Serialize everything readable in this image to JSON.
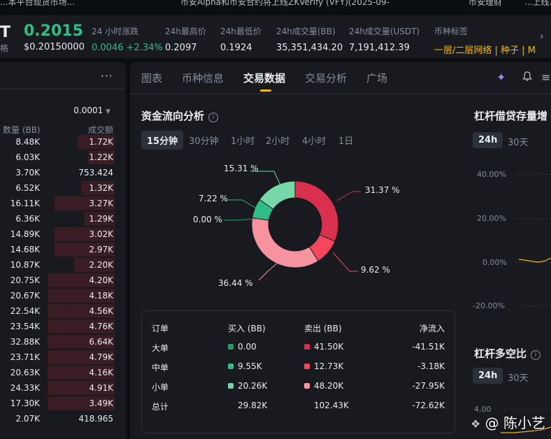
{
  "news": [
    "...本平台现货市场...",
    "币安Alpha和币安合约将上线ZKVerify (VFY)(2025-09-",
    "币安理财",
    "...上线..."
  ],
  "ticker": {
    "symbol": "T",
    "symbol_sub": "格",
    "price": "0.2015",
    "price_sub": "$0.20150000",
    "stats": [
      {
        "label": "24 小时涨跌",
        "value": "0.0046 +2.34%",
        "tone": "green"
      },
      {
        "label": "24h最高价",
        "value": "0.2097",
        "tone": ""
      },
      {
        "label": "24h最低价",
        "value": "0.1924",
        "tone": ""
      },
      {
        "label": "24h成交量(BB)",
        "value": "35,351,434.20",
        "tone": ""
      },
      {
        "label": "24h成交量(USDT)",
        "value": "7,191,412.39",
        "tone": ""
      },
      {
        "label": "币种标签",
        "value": "一层/二层网络 | 种子 | Me",
        "tone": "yellow"
      }
    ]
  },
  "orderbook": {
    "precision": "0.0001",
    "col_qty": "数量 (BB)",
    "col_total": "成交额",
    "rows": [
      {
        "qty": "8.48K",
        "total": "1.72K",
        "depth": 0.55
      },
      {
        "qty": "6.03K",
        "total": "1.22K",
        "depth": 0.4
      },
      {
        "qty": "3.70K",
        "total": "753.424",
        "depth": 0.0
      },
      {
        "qty": "6.52K",
        "total": "1.32K",
        "depth": 0.5
      },
      {
        "qty": "16.11K",
        "total": "3.27K",
        "depth": 0.9
      },
      {
        "qty": "6.36K",
        "total": "1.29K",
        "depth": 0.45
      },
      {
        "qty": "14.89K",
        "total": "3.02K",
        "depth": 0.9
      },
      {
        "qty": "14.68K",
        "total": "2.97K",
        "depth": 0.9
      },
      {
        "qty": "10.87K",
        "total": "2.20K",
        "depth": 0.6
      },
      {
        "qty": "20.75K",
        "total": "4.20K",
        "depth": 1.0
      },
      {
        "qty": "20.67K",
        "total": "4.18K",
        "depth": 1.0
      },
      {
        "qty": "22.54K",
        "total": "4.56K",
        "depth": 1.0
      },
      {
        "qty": "23.54K",
        "total": "4.76K",
        "depth": 1.0
      },
      {
        "qty": "32.88K",
        "total": "6.64K",
        "depth": 1.0
      },
      {
        "qty": "23.71K",
        "total": "4.79K",
        "depth": 1.0
      },
      {
        "qty": "20.63K",
        "total": "4.16K",
        "depth": 1.0
      },
      {
        "qty": "24.33K",
        "total": "4.91K",
        "depth": 1.0
      },
      {
        "qty": "17.30K",
        "total": "3.49K",
        "depth": 1.0
      },
      {
        "qty": "2.07K",
        "total": "418.965",
        "depth": 0.0
      }
    ]
  },
  "tabs": [
    "图表",
    "币种信息",
    "交易数据",
    "交易分析",
    "广场"
  ],
  "active_tab": 2,
  "fund_flow": {
    "title": "资金流向分析",
    "intervals": [
      "15分钟",
      "30分钟",
      "1小时",
      "2小时",
      "4小时",
      "1日"
    ],
    "active_interval": 0,
    "table": {
      "headers": [
        "订单",
        "买入 (BB)",
        "卖出 (BB)",
        "净流入"
      ],
      "rows": [
        {
          "name": "大单",
          "buy": "0.00",
          "sell": "41.50K",
          "net": "-41.51K",
          "buy_color": "#1e9e63",
          "sell_color": "#d9304e"
        },
        {
          "name": "中单",
          "buy": "9.55K",
          "sell": "12.73K",
          "net": "-3.18K",
          "buy_color": "#2ebd85",
          "sell_color": "#f6465d"
        },
        {
          "name": "小单",
          "buy": "20.26K",
          "sell": "48.20K",
          "net": "-27.95K",
          "buy_color": "#76d8a8",
          "sell_color": "#f7939e"
        },
        {
          "name": "总计",
          "buy": "29.82K",
          "sell": "102.43K",
          "net": "-72.62K",
          "buy_color": "",
          "sell_color": ""
        }
      ]
    }
  },
  "chart_data": {
    "type": "pie",
    "title": "资金流向分析",
    "slices": [
      {
        "label": "31.37 %",
        "value": 31.37,
        "color": "#d9304e"
      },
      {
        "label": "9.62 %",
        "value": 9.62,
        "color": "#f6465d"
      },
      {
        "label": "36.44 %",
        "value": 36.44,
        "color": "#f7939e"
      },
      {
        "label": "0.00 %",
        "value": 0.0,
        "color": "#1e9e63"
      },
      {
        "label": "7.22 %",
        "value": 7.22,
        "color": "#2ebd85"
      },
      {
        "label": "15.31 %",
        "value": 15.31,
        "color": "#76d8a8"
      }
    ]
  },
  "leverage": {
    "title1": "杠杆借贷存量增",
    "title2": "杠杆多空比",
    "periods": [
      "24h",
      "30天"
    ],
    "axis": [
      "40.00%",
      "20.00%",
      "0.00%",
      "-20.00%"
    ],
    "axis2_top": "4.00"
  },
  "watermark": "@ 陈小艺"
}
